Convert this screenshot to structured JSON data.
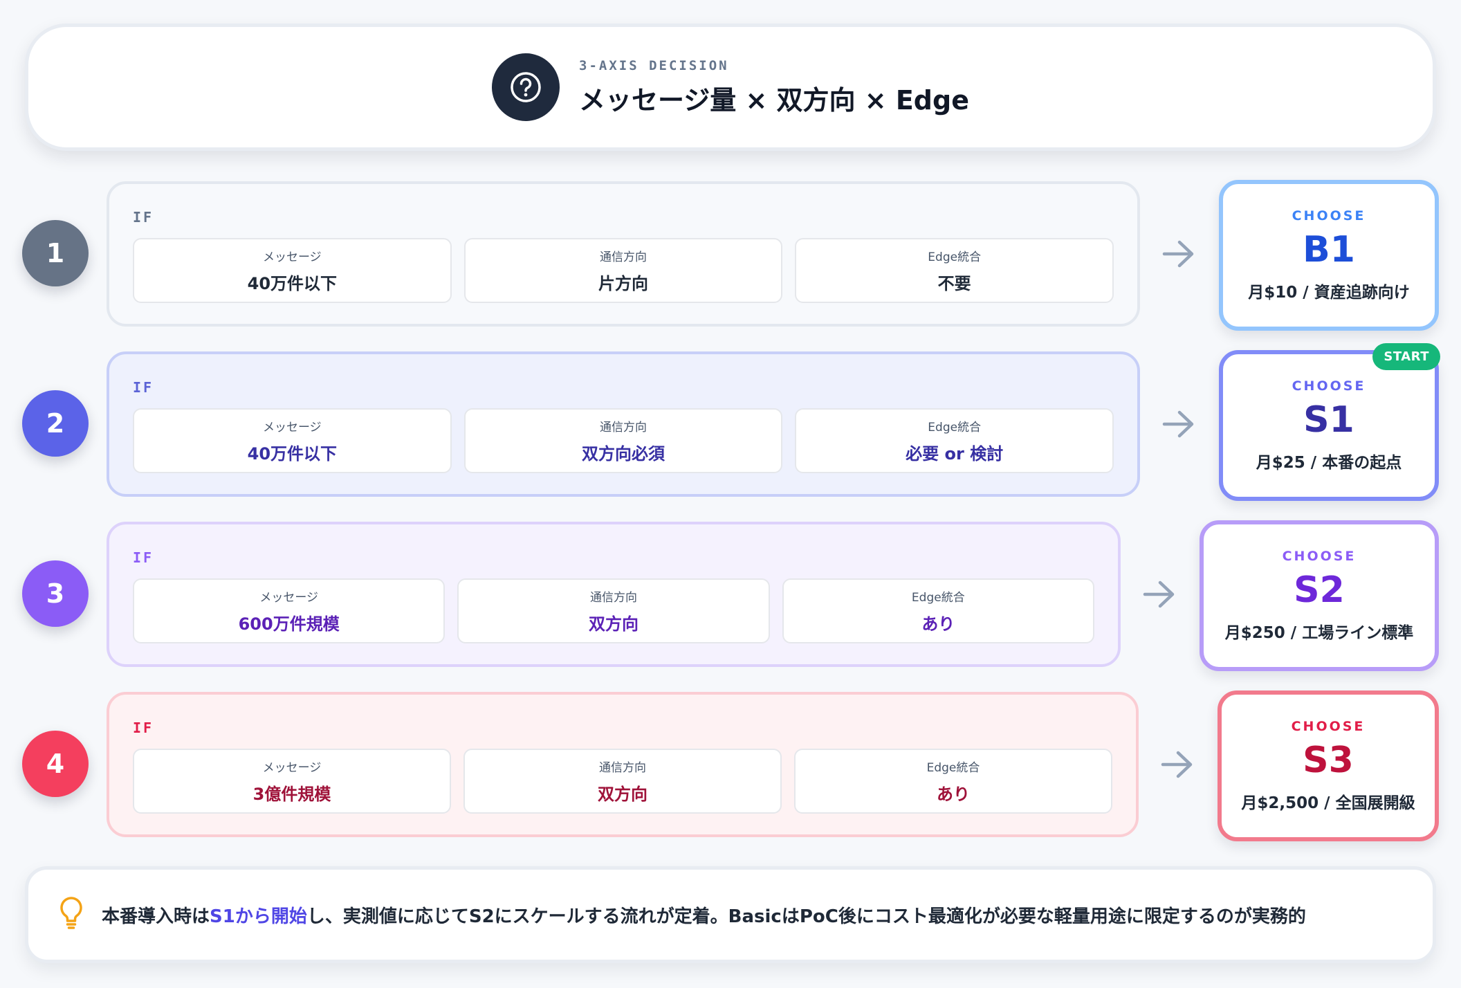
{
  "header": {
    "subtitle": "3-AXIS DECISION",
    "title": "メッセージ量 × 双方向 × Edge",
    "icon": "question-circle-icon"
  },
  "rows": [
    {
      "number": "1",
      "if_label": "IF",
      "conditions": [
        {
          "label": "メッセージ",
          "value": "40万件以下"
        },
        {
          "label": "通信方向",
          "value": "片方向"
        },
        {
          "label": "Edge統合",
          "value": "不要"
        }
      ],
      "choose_label": "CHOOSE",
      "code": "B1",
      "description": "月$10 / 資産追跡向け",
      "colors": {
        "number": "#667386",
        "panel_bg": "#f7f9fc",
        "panel_border": "#e3e8ef",
        "if": "#64748b",
        "value": "#1f2937",
        "accent": "#3b82f6",
        "code": "#1d4ed8",
        "choice_border": "#93c5fd"
      }
    },
    {
      "number": "2",
      "if_label": "IF",
      "conditions": [
        {
          "label": "メッセージ",
          "value": "40万件以下"
        },
        {
          "label": "通信方向",
          "value": "双方向必須"
        },
        {
          "label": "Edge統合",
          "value": "必要 or 検討"
        }
      ],
      "choose_label": "CHOOSE",
      "code": "S1",
      "description": "月$25 / 本番の起点",
      "badge": "START",
      "colors": {
        "number": "#5b63e8",
        "panel_bg": "#eef1fd",
        "panel_border": "#c7cff8",
        "if": "#5b63d6",
        "value": "#3730a3",
        "accent": "#6366f1",
        "code": "#3730a3",
        "choice_border": "#818cf8"
      }
    },
    {
      "number": "3",
      "if_label": "IF",
      "conditions": [
        {
          "label": "メッセージ",
          "value": "600万件規模"
        },
        {
          "label": "通信方向",
          "value": "双方向"
        },
        {
          "label": "Edge統合",
          "value": "あり"
        }
      ],
      "choose_label": "CHOOSE",
      "code": "S2",
      "description": "月$250 / 工場ライン標準",
      "colors": {
        "number": "#8b5cf6",
        "panel_bg": "#f5f2fe",
        "panel_border": "#ddd2fb",
        "if": "#8b5cf6",
        "value": "#5b21b6",
        "accent": "#8b5cf6",
        "code": "#6d28d9",
        "choice_border": "#b79cf8"
      }
    },
    {
      "number": "4",
      "if_label": "IF",
      "conditions": [
        {
          "label": "メッセージ",
          "value": "3億件規模"
        },
        {
          "label": "通信方向",
          "value": "双方向"
        },
        {
          "label": "Edge統合",
          "value": "あり"
        }
      ],
      "choose_label": "CHOOSE",
      "code": "S3",
      "description": "月$2,500 / 全国展開級",
      "colors": {
        "number": "#f43f5e",
        "panel_bg": "#fef2f3",
        "panel_border": "#fbcdd3",
        "if": "#e11d48",
        "value": "#9f1239",
        "accent": "#e11d48",
        "code": "#be123c",
        "choice_border": "#f27a8c"
      }
    }
  ],
  "footer": {
    "icon": "lightbulb-icon",
    "text_before": "本番導入時は",
    "text_accent": "S1から開始",
    "text_after": "し、実測値に応じてS2にスケールする流れが定着。BasicはPoC後にコスト最適化が必要な軽量用途に限定するのが実務的"
  }
}
